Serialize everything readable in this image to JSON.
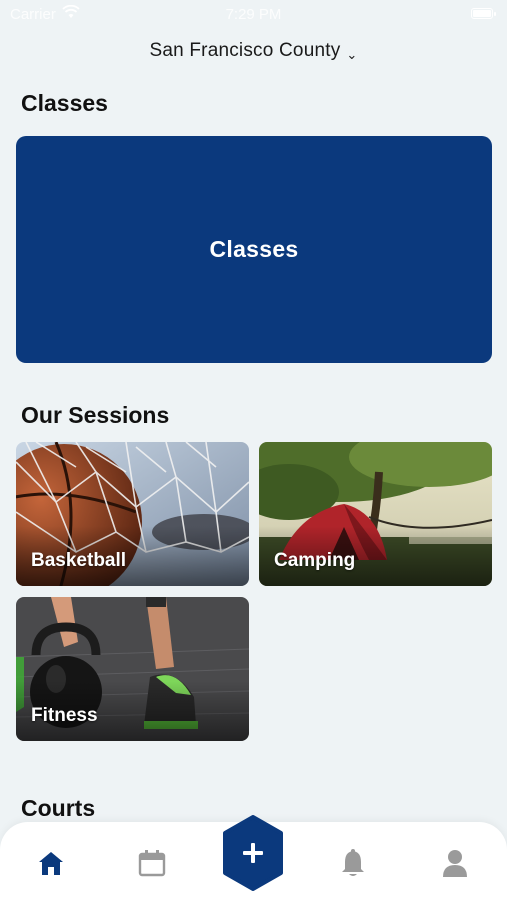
{
  "status_bar": {
    "carrier": "Carrier",
    "time": "7:29 PM"
  },
  "location": {
    "label": "San Francisco County",
    "chevron": "⌄"
  },
  "sections": {
    "classes_title": "Classes",
    "sessions_title": "Our Sessions",
    "courts_title": "Courts"
  },
  "classes_card": {
    "label": "Classes",
    "color": "#0b397d"
  },
  "sessions": [
    {
      "label": "Basketball",
      "image": "basketball-hoop-photo"
    },
    {
      "label": "Camping",
      "image": "tent-under-tree-photo"
    },
    {
      "label": "Fitness",
      "image": "kettlebell-photo"
    }
  ],
  "tab_bar": {
    "items": [
      {
        "name": "home",
        "icon": "home-icon",
        "active": true
      },
      {
        "name": "calendar",
        "icon": "calendar-icon",
        "active": false
      },
      {
        "name": "add",
        "icon": "plus-icon",
        "active": false
      },
      {
        "name": "notifications",
        "icon": "bell-icon",
        "active": false
      },
      {
        "name": "profile",
        "icon": "user-icon",
        "active": false
      }
    ],
    "active_color": "#0b397d",
    "inactive_color": "#9a9a9a"
  }
}
